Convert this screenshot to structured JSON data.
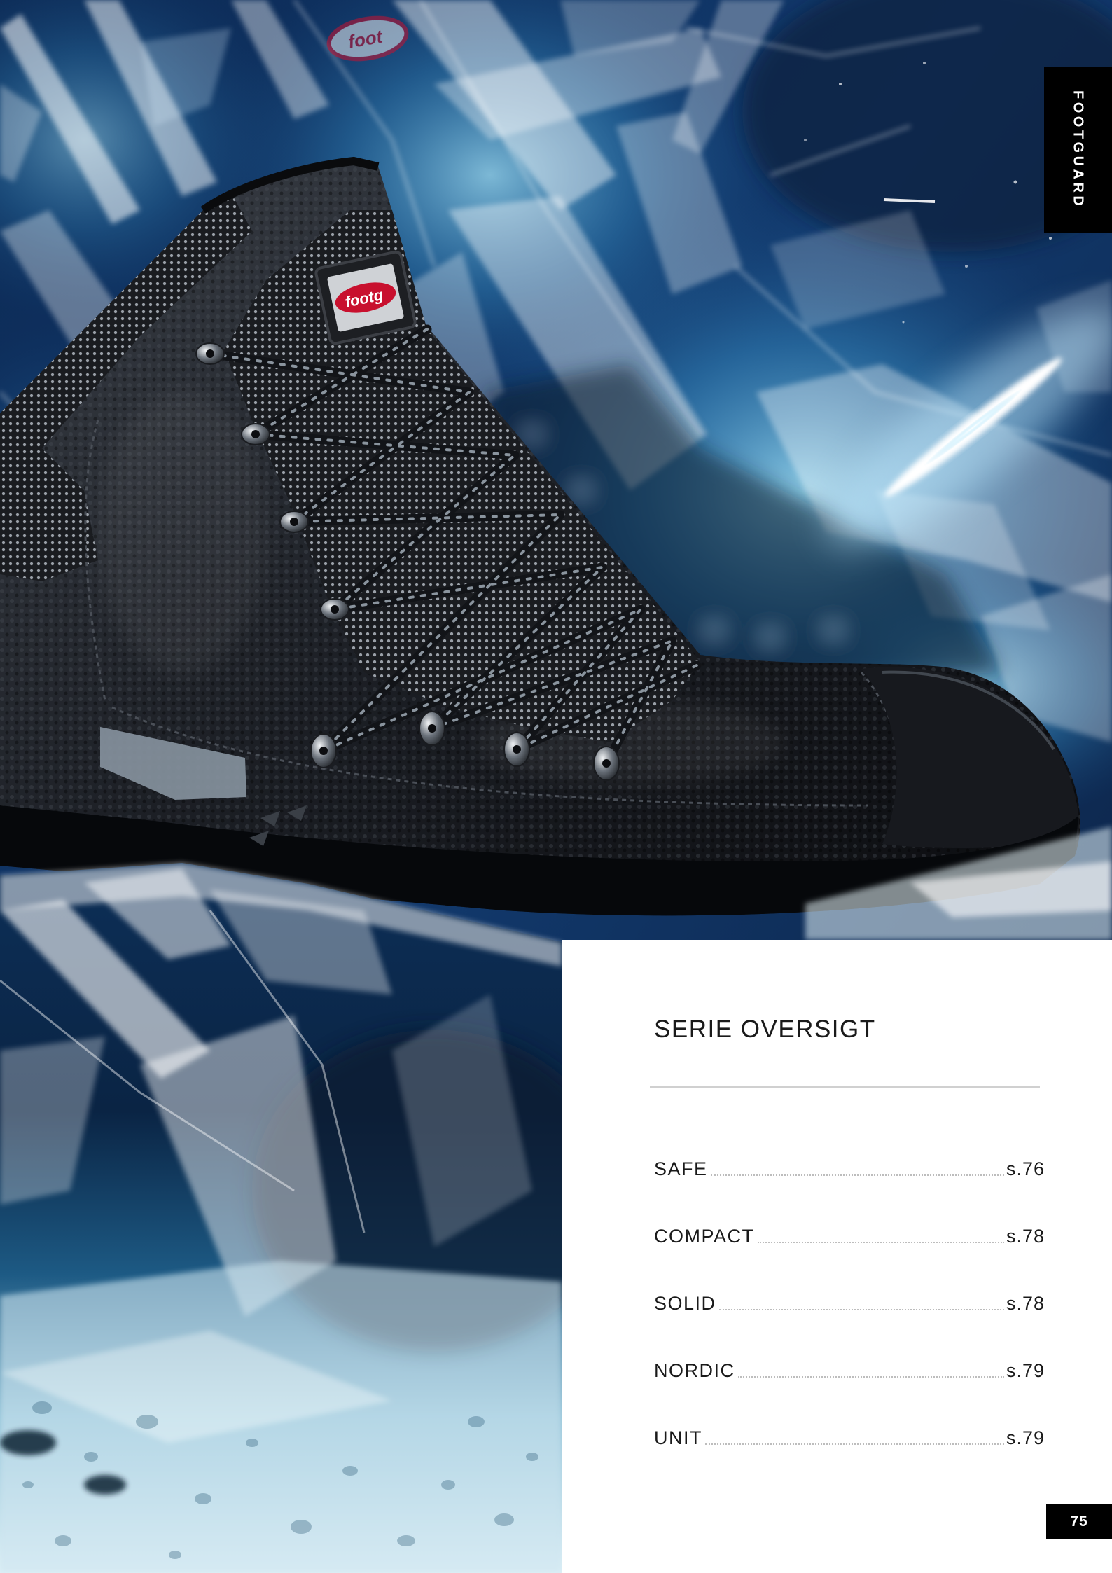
{
  "brand_tab": {
    "label": "FOOTGUARD"
  },
  "boot_logos": {
    "main": "footg",
    "background": "foot"
  },
  "section": {
    "title": "SERIE OVERSIGT"
  },
  "toc": {
    "entries": [
      {
        "label": "SAFE",
        "page": "s.76"
      },
      {
        "label": "COMPACT",
        "page": "s.78"
      },
      {
        "label": "SOLID",
        "page": "s.78"
      },
      {
        "label": "NORDIC",
        "page": "s.79"
      },
      {
        "label": "UNIT",
        "page": "s.79"
      }
    ]
  },
  "page_number": "75",
  "colors": {
    "tab_background": "#000000",
    "panel_background": "#ffffff",
    "text": "#1a1a1a",
    "leader_dots": "#bdbdbd",
    "ice_dark": "#0b2348",
    "ice_light": "#bfe6f5",
    "logo_red": "#c8102e"
  }
}
